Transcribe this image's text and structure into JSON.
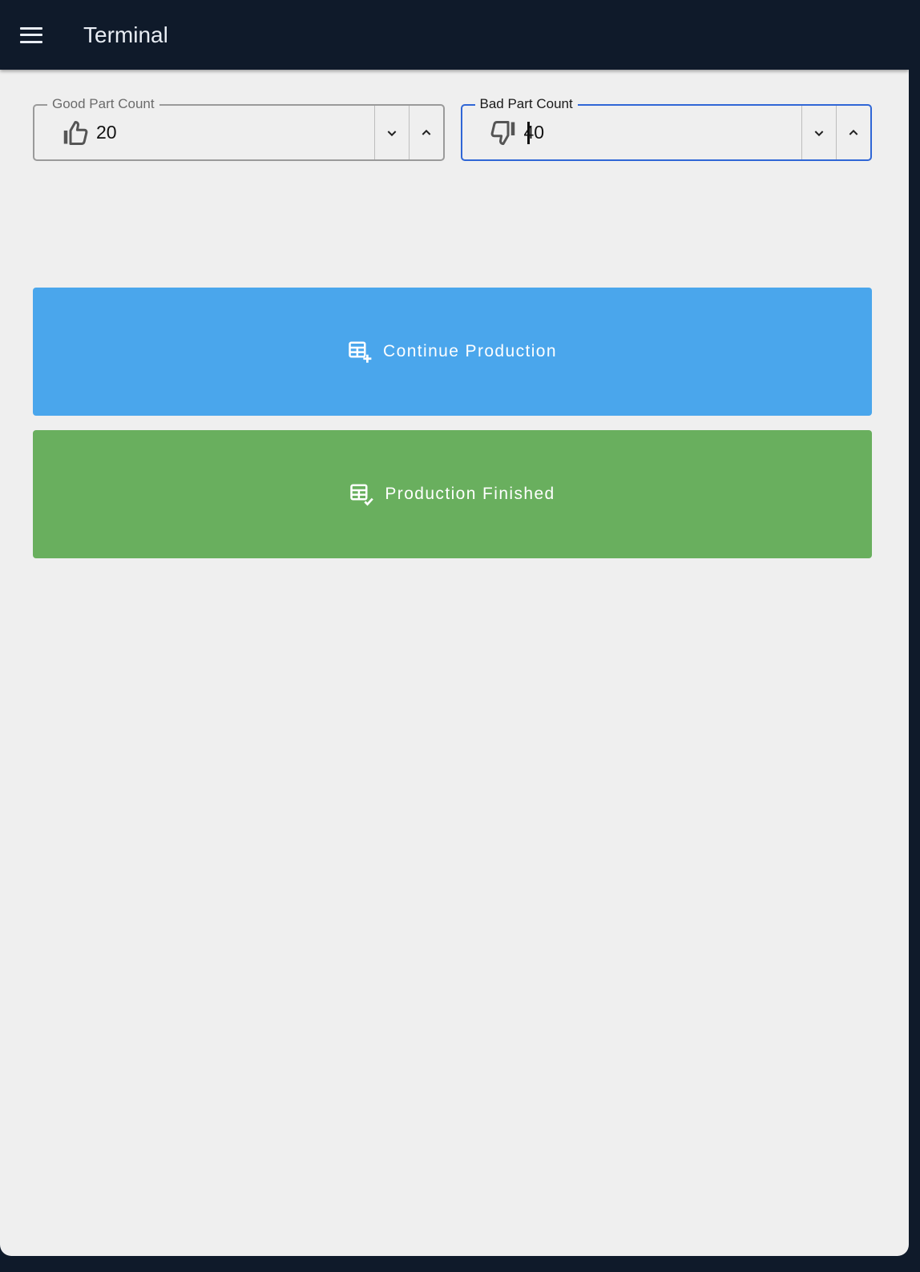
{
  "app": {
    "title": "Terminal"
  },
  "fields": {
    "good": {
      "label": "Good Part Count",
      "value": "20"
    },
    "bad": {
      "label": "Bad Part Count",
      "value": "40"
    }
  },
  "buttons": {
    "continue_label": "Continue Production",
    "finish_label": "Production Finished"
  },
  "colors": {
    "appbar": "#0f1a2a",
    "background": "#efefef",
    "focus": "#2f66d6",
    "continue": "#4aa6ec",
    "finish": "#69af5e"
  },
  "icons": {
    "menu": "menu-icon",
    "good": "thumb-up-icon",
    "bad": "thumb-down-icon",
    "decrement": "chevron-down-icon",
    "increment": "chevron-up-icon",
    "continue": "table-plus-icon",
    "finish": "table-check-icon"
  }
}
